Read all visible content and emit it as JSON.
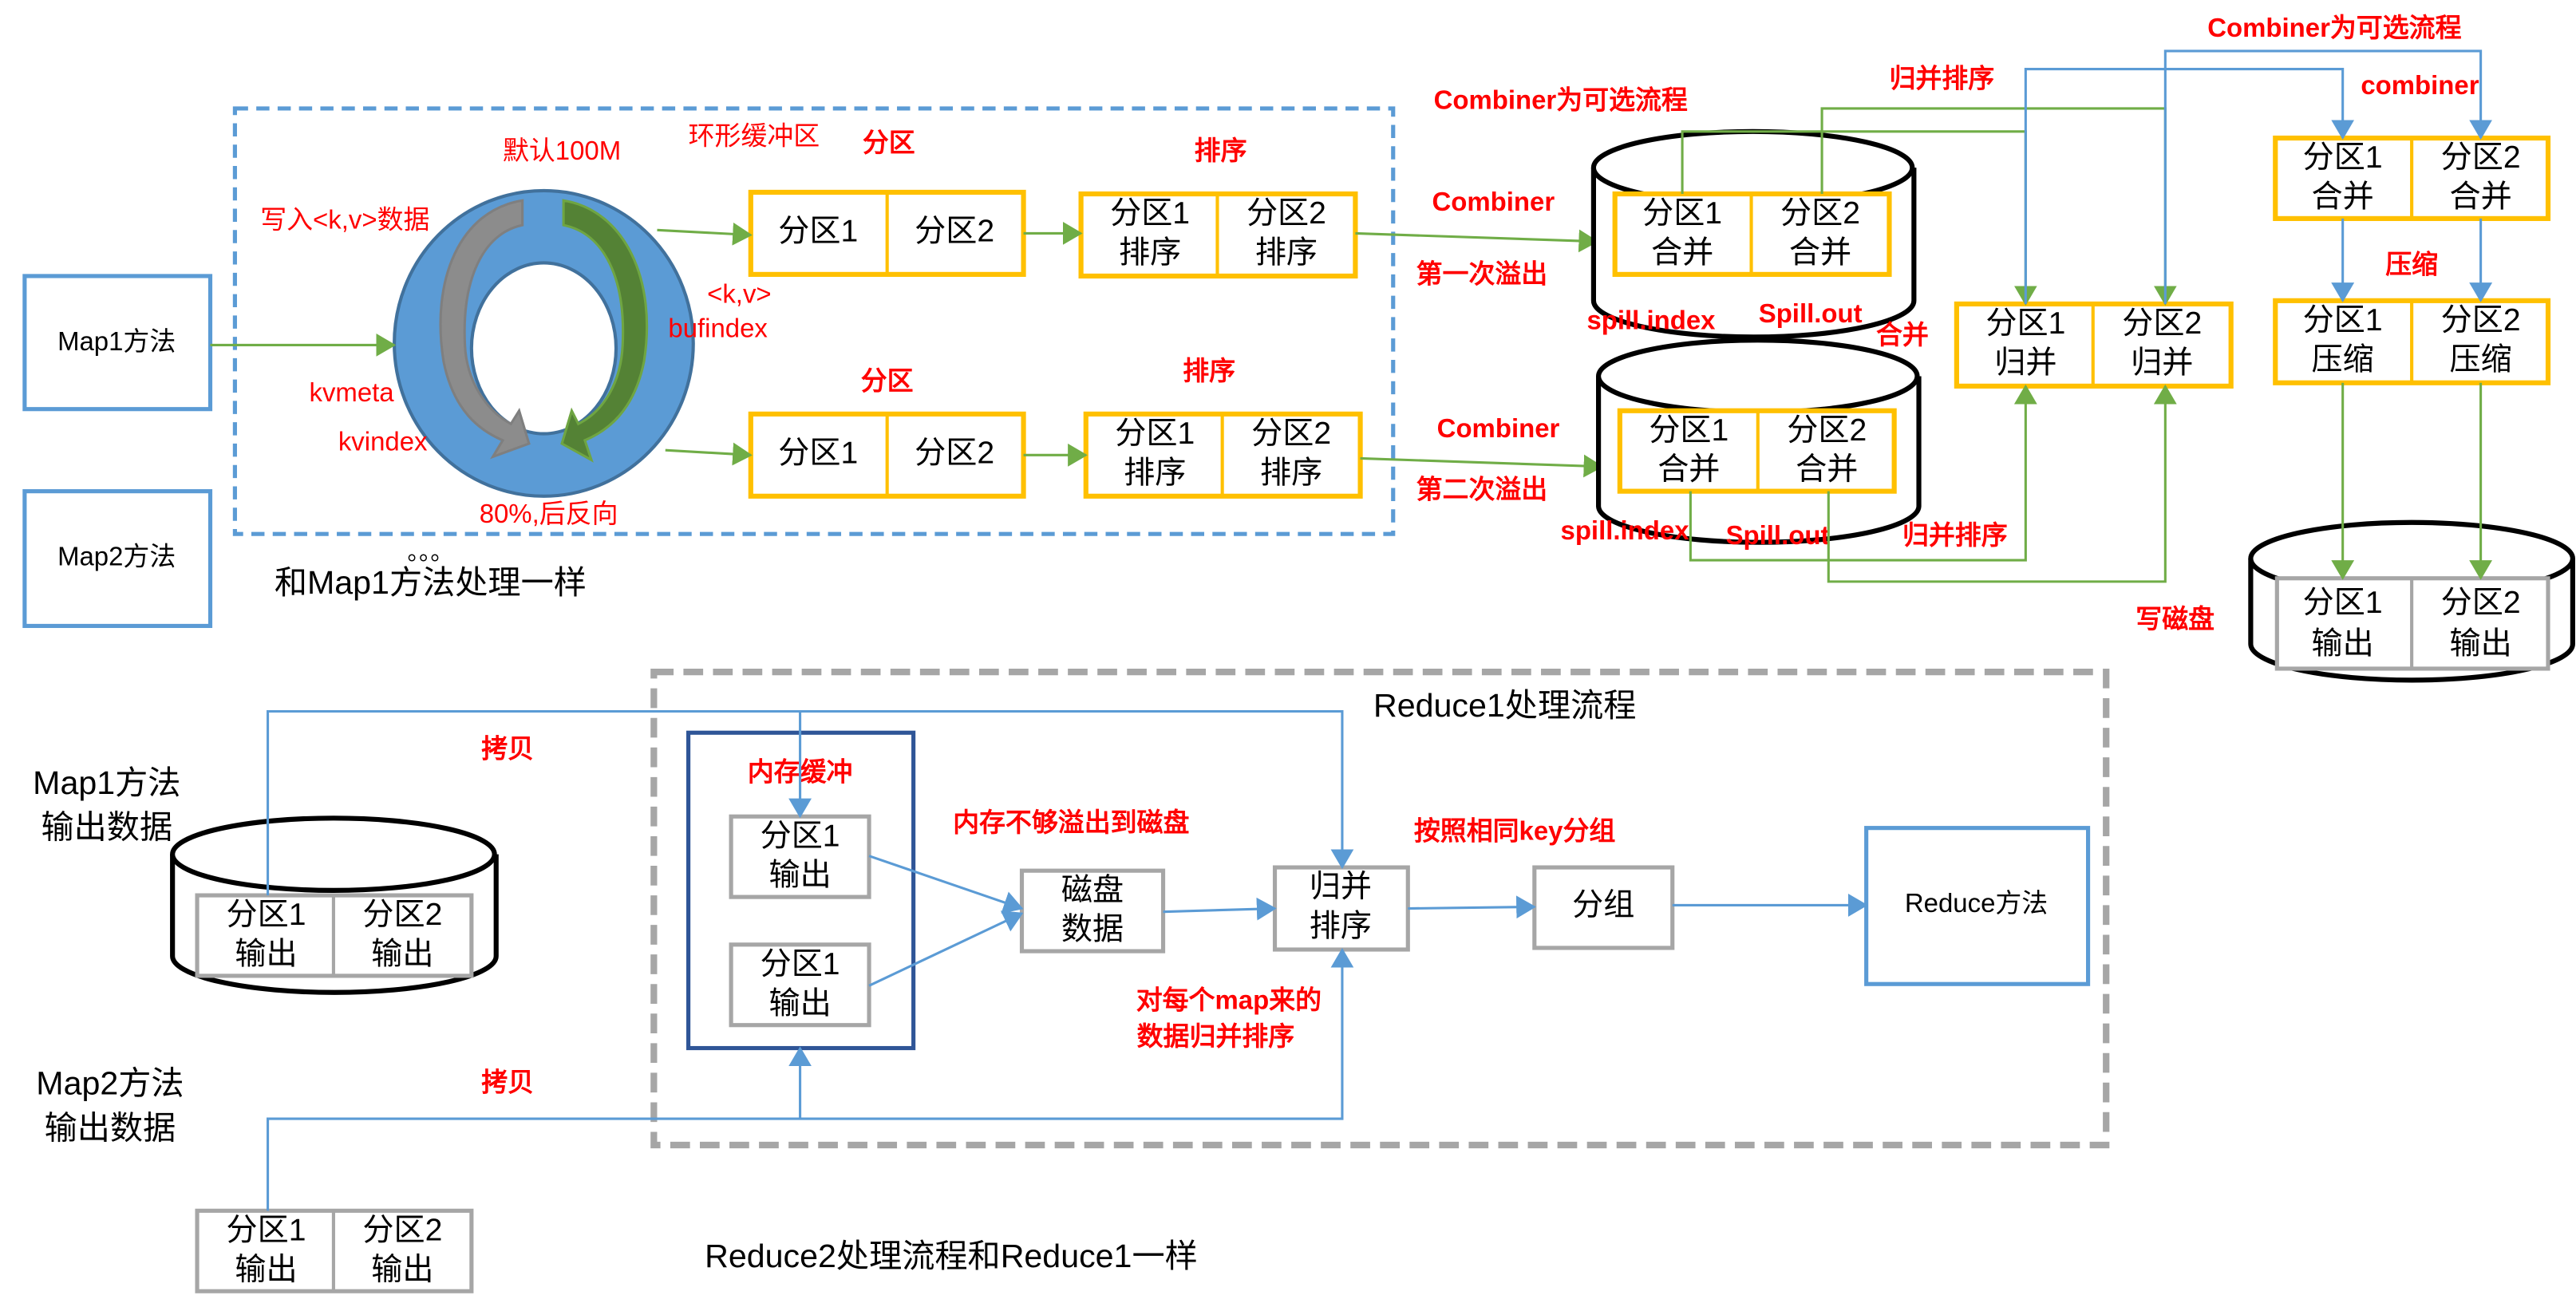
{
  "map_phase": {
    "map1": "Map1方法",
    "map2": "Map2方法",
    "same_as_map1": "和Map1方法处理一样",
    "dots": "。。。",
    "ring_buffer": "环形缓冲区",
    "default_size": "默认100M",
    "write_kv": "写入<k,v>数据",
    "kv": "<k,v>",
    "bufindex": "bufindex",
    "kvmeta": "kvmeta",
    "kvindex": "kvindex",
    "reverse": "80%,后反向",
    "partition_label": "分区",
    "sort_label": "排序",
    "p1": "分区1",
    "p2": "分区2",
    "sort_word": "排序",
    "merge_word": "合并",
    "combine_optional": "Combiner为可选流程",
    "combiner": "Combiner",
    "first_spill": "第一次溢出",
    "second_spill": "第二次溢出",
    "spill_index": "spill.index",
    "spill_out": "Spill.out",
    "merge_label": "合并",
    "merge_sort": "归并排序",
    "merge_box_word": "归并",
    "combine_optional2": "Combiner为可选流程",
    "combiner_lower": "combiner",
    "compress_label": "压缩",
    "compress_word": "压缩",
    "write_disk": "写磁盘",
    "output_word": "输出"
  },
  "reduce_phase": {
    "title": "Reduce1处理流程",
    "map1_out_1": "Map1方法",
    "map1_out_2": "输出数据",
    "map2_out_1": "Map2方法",
    "map2_out_2": "输出数据",
    "copy": "拷贝",
    "mem_buffer": "内存缓冲",
    "p1": "分区1",
    "p2": "分区2",
    "output_word": "输出",
    "spill_to_disk": "内存不够溢出到磁盘",
    "disk_1": "磁盘",
    "disk_2": "数据",
    "merge_1": "归并",
    "merge_2": "排序",
    "per_map_1": "对每个map来的",
    "per_map_2": "数据归并排序",
    "group_by_key": "按照相同key分组",
    "group": "分组",
    "reduce_method": "Reduce方法",
    "reduce2_note": "Reduce2处理流程和Reduce1一样"
  },
  "colors": {
    "accent_blue": "#5b9bd5",
    "arrow_green": "#70ad47",
    "partition_yellow": "#ffc000",
    "label_red": "#ff0000",
    "gray": "#a6a6a6"
  }
}
